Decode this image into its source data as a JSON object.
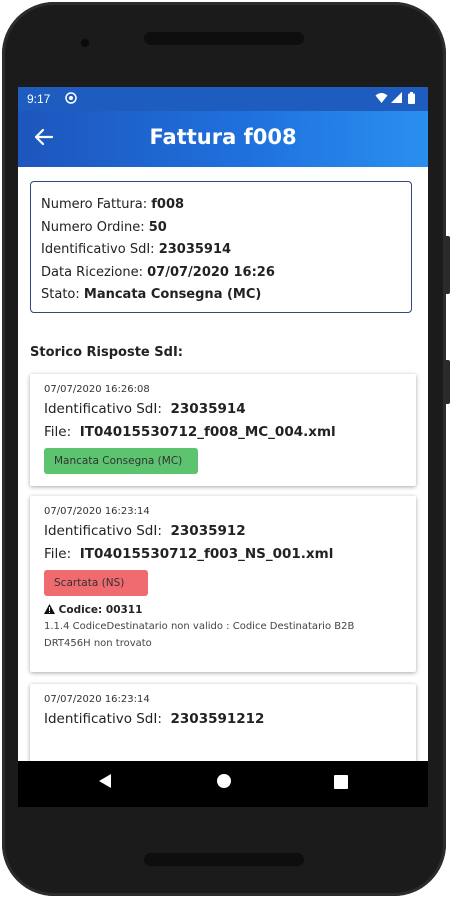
{
  "status_bar": {
    "time": "9:17",
    "left_icon": "at-icon",
    "right_icons": [
      "wifi-icon",
      "signal-icon",
      "battery-icon"
    ]
  },
  "app_bar": {
    "back_icon": "back-arrow-icon",
    "title": "Fattura f008",
    "gradient_colors": [
      "#1d56bc",
      "#2a8ff0"
    ]
  },
  "invoice_info": {
    "numero_fattura_label": "Numero Fattura: ",
    "numero_fattura_value": "f008",
    "numero_ordine_label": "Numero Ordine: ",
    "numero_ordine_value": "50",
    "identificativo_label": "Identificativo SdI: ",
    "identificativo_value": "23035914",
    "data_ricezione_label": "Data Ricezione: ",
    "data_ricezione_value": "07/07/2020 16:26",
    "stato_label": "Stato: ",
    "stato_value": "Mancata Consegna (MC)"
  },
  "history": {
    "title": "Storico Risposte SdI:",
    "items": [
      {
        "date": "07/07/2020 16:26:08",
        "identificativo_label": "Identificativo SdI:",
        "identificativo_value": "23035914",
        "file_label": "File:",
        "file_value": "IT04015530712_f008_MC_004.xml",
        "badge": "Mancata Consegna (MC)",
        "badge_color": "#5cc36f"
      },
      {
        "date": "07/07/2020 16:23:14",
        "identificativo_label": "Identificativo SdI:",
        "identificativo_value": "23035912",
        "file_label": "File:",
        "file_value": "IT04015530712_f003_NS_001.xml",
        "badge": "Scartata (NS)",
        "badge_color": "#ef6b6f",
        "error_icon": "warning-icon",
        "error_code": "Codice: 00311",
        "error_message": "1.1.4 CodiceDestinatario non valido : Codice Destinatario B2B DRT456H non trovato"
      },
      {
        "date": "07/07/2020 16:23:14",
        "identificativo_label": "Identificativo SdI:",
        "identificativo_value": "2303591212"
      }
    ]
  },
  "nav_bar": {
    "back": "nav-back-icon",
    "home": "nav-home-icon",
    "recents": "nav-recents-icon"
  }
}
